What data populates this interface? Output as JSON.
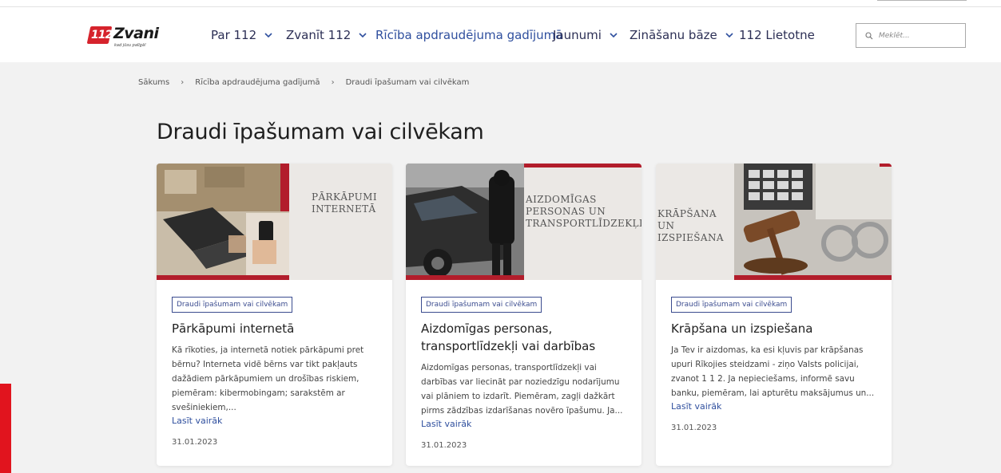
{
  "header": {
    "logo": {
      "number": "112",
      "brand": "Zvani",
      "tagline": "kad jūsu palīgā!"
    },
    "nav": [
      {
        "label": "Par 112",
        "has_dropdown": true
      },
      {
        "label": "Zvanīt 112",
        "has_dropdown": true
      },
      {
        "label": "Rīcība apdraudējuma gadījumā",
        "has_dropdown": false,
        "active": true
      },
      {
        "label": "Jaunumi",
        "has_dropdown": true
      },
      {
        "label": "Zināšanu bāze",
        "has_dropdown": true
      },
      {
        "label": "112 Lietotne",
        "has_dropdown": false
      }
    ],
    "search": {
      "placeholder": "Meklēt..."
    }
  },
  "breadcrumb": [
    "Sākums",
    "Rīcība apdraudējuma gadījumā",
    "Draudi īpašumam vai cilvēkam"
  ],
  "page_title": "Draudi īpašumam vai cilvēkam",
  "cards": [
    {
      "image_text": "PĀRKĀPUMI INTERNETĀ",
      "tag": "Draudi īpašumam vai cilvēkam",
      "title": "Pārkāpumi internetā",
      "excerpt": "Kā rīkoties, ja internetā notiek pārkāpumi pret bērnu? Interneta vidē bērns var tikt pakļauts dažādiem pārkāpumiem un drošības riskiem, piemēram: kibermobingam; sarakstēm ar svešiniekiem,...",
      "read_more": "Lasīt vairāk",
      "date": "31.01.2023"
    },
    {
      "image_text": "AIZDOMĪGAS PERSONAS UN TRANSPORTLĪDZEKĻI",
      "tag": "Draudi īpašumam vai cilvēkam",
      "title": "Aizdomīgas personas, transportlīdzekļi vai darbības",
      "excerpt": "Aizdomīgas personas, transportlīdzekļi vai darbības var liecināt par noziedzīgu nodarījumu vai plāniem to izdarīt. Piemēram, zagļi dažkārt pirms zādzības izdarīšanas novēro īpašumu. Ja...",
      "read_more": "Lasīt vairāk",
      "date": "31.01.2023"
    },
    {
      "image_text": "KRĀPŠANA UN IZSPIEŠANA",
      "tag": "Draudi īpašumam vai cilvēkam",
      "title": "Krāpšana un izspiešana",
      "excerpt": "Ja Tev ir aizdomas, ka esi kļuvis par krāpšanas upuri Rīkojies steidzami - ziņo Valsts policijai, zvanot 1 1 2. Ja nepieciešams, informē savu banku, piemēram, lai apturētu maksājumus un...",
      "read_more": "Lasīt vairāk",
      "date": "31.01.2023"
    }
  ],
  "colors": {
    "brand_red": "#d6232c",
    "link_blue": "#2f4f9e",
    "nav_text": "#2c2f55",
    "page_bg": "#f2f2f2"
  }
}
